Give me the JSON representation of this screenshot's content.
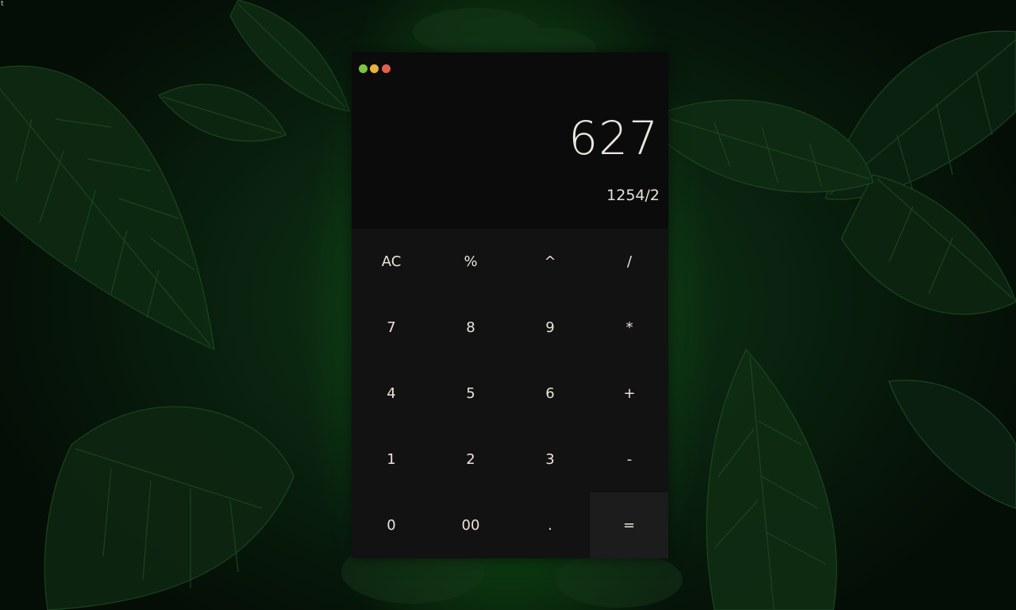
{
  "desktop": {
    "corner_text": "t"
  },
  "window": {
    "controls": [
      "green",
      "yellow",
      "red"
    ]
  },
  "display": {
    "result": "627",
    "expression": "1254/2"
  },
  "keypad": {
    "rows": [
      [
        "AC",
        "%",
        "^",
        "/"
      ],
      [
        "7",
        "8",
        "9",
        "*"
      ],
      [
        "4",
        "5",
        "6",
        "+"
      ],
      [
        "1",
        "2",
        "3",
        "-"
      ],
      [
        "0",
        "00",
        ".",
        "="
      ]
    ]
  },
  "colors": {
    "window_bg": "#0b0b0b",
    "keypad_bg": "#121212",
    "equals_bg": "#1c1c1c",
    "text": "#ece4da",
    "control_green": "#7cc443",
    "control_yellow": "#e9b23a",
    "control_red": "#e2604c"
  }
}
